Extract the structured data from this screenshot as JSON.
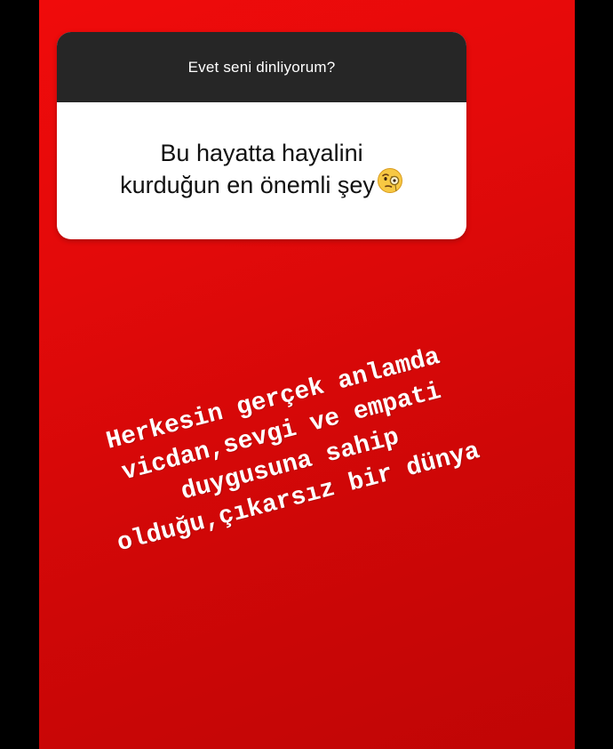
{
  "question_sticker": {
    "prompt": "Evet seni dinliyorum?",
    "answer_text": "Bu hayatta hayalini\nkurduğun en önemli şey",
    "answer_line1": "Bu hayatta hayalini",
    "answer_line2": "kurduğun en önemli şey",
    "emoji": "face-with-monocle-icon"
  },
  "reply": {
    "lines": [
      "Herkesin gerçek anlamda",
      "vicdan,sevgi ve empati",
      "duygusuna sahip",
      "olduğu,çıkarsız bir dünya"
    ]
  },
  "colors": {
    "background": "#000000",
    "story_red": "#e00909",
    "sticker_header": "#262626",
    "sticker_body": "#ffffff",
    "reply_text": "#ffffff"
  }
}
